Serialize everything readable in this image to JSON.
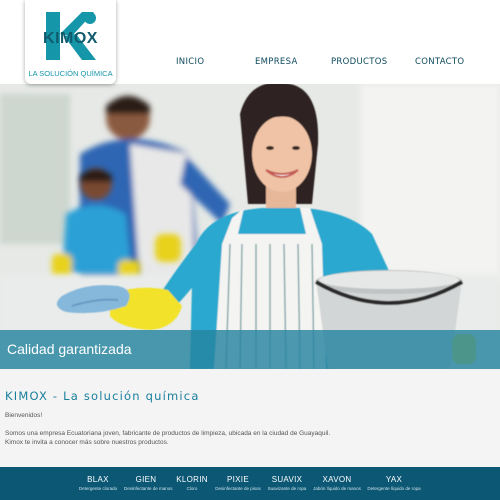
{
  "header": {
    "logo": {
      "wordmark": "KIMOX",
      "tagline": "LA SOLUCIÓN QUÍMICA"
    },
    "nav": [
      {
        "label": "INICIO"
      },
      {
        "label": "EMPRESA"
      },
      {
        "label": "PRODUCTOS"
      },
      {
        "label": "CONTACTO"
      }
    ]
  },
  "hero": {
    "caption": "Calidad garantizada"
  },
  "content": {
    "title": "KIMOX - La solución química",
    "welcome": "Bienvenidos!",
    "description_line1": "Somos una empresa Ecuatoriana joven, fabricante de productos de limpieza, ubicada en la ciudad de Guayaquil.",
    "description_line2": "Kimox te invita a conocer más sobre nuestros productos."
  },
  "footer": {
    "products": [
      {
        "name": "BLAX",
        "desc": "Detergente clorado"
      },
      {
        "name": "GIEN",
        "desc": "Desinfectante de manos"
      },
      {
        "name": "KLORIN",
        "desc": "Cloro"
      },
      {
        "name": "PIXIE",
        "desc": "Desinfectante de pisos"
      },
      {
        "name": "SUAVIX",
        "desc": "Suavizante de ropa"
      },
      {
        "name": "XAVON",
        "desc": "Jabón líquido de manos"
      },
      {
        "name": "YAX",
        "desc": "Detergente líquido de ropa"
      }
    ]
  },
  "colors": {
    "brand_teal": "#1596a9",
    "brand_dark": "#0d4a5e",
    "footer_bg": "#0b5774",
    "caption_bar": "#2684a0"
  }
}
